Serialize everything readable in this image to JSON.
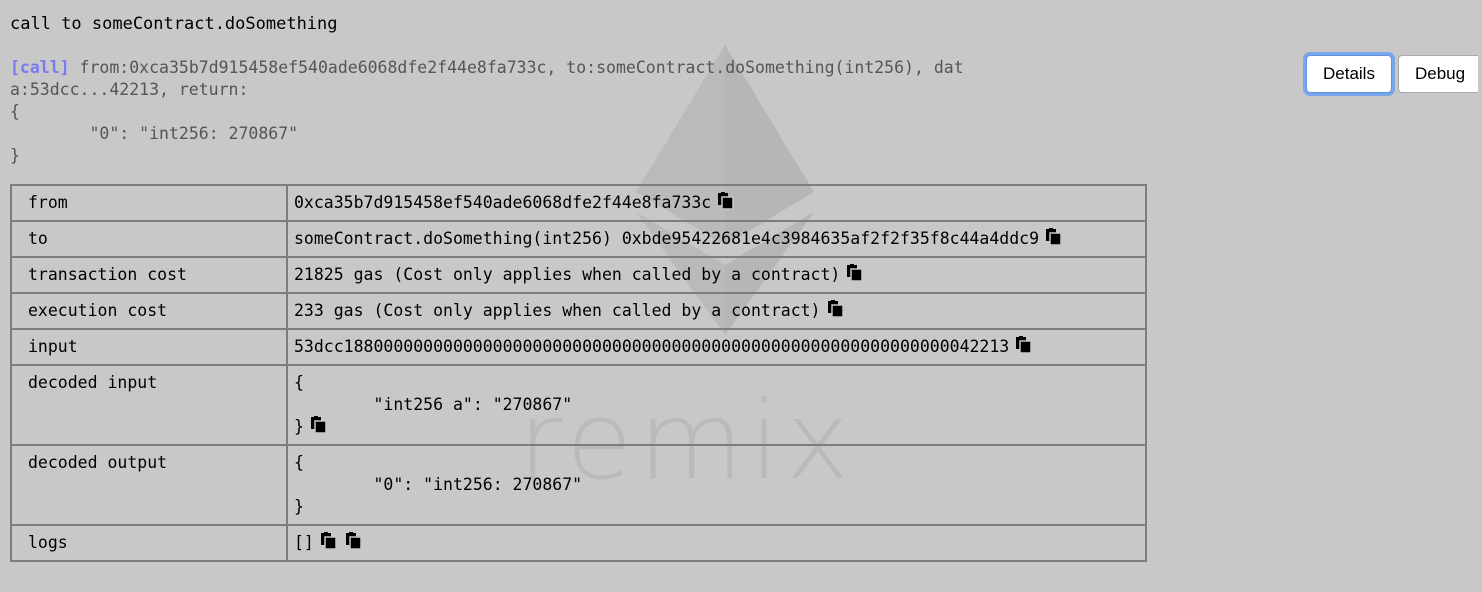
{
  "title": "call to someContract.doSomething",
  "log": {
    "tag": "[call]",
    "line1": " from:0xca35b7d915458ef540ade6068dfe2f44e8fa733c, to:someContract.doSomething(int256), dat",
    "line2": "a:53dcc...42213, return:",
    "line3": "{",
    "line4": "\t\"0\": \"int256: 270867\"",
    "line5": "}"
  },
  "buttons": {
    "details": "Details",
    "debug": "Debug"
  },
  "watermark": "remix",
  "rows": {
    "from": {
      "key": "from",
      "value": "0xca35b7d915458ef540ade6068dfe2f44e8fa733c"
    },
    "to": {
      "key": "to",
      "value": "someContract.doSomething(int256) 0xbde95422681e4c3984635af2f2f35f8c44a4ddc9"
    },
    "tx_cost": {
      "key": "transaction cost",
      "value": "21825 gas (Cost only applies when called by a contract)"
    },
    "exec_cost": {
      "key": "execution cost",
      "value": "233 gas (Cost only applies when called by a contract)"
    },
    "input": {
      "key": "input",
      "value": "53dcc1880000000000000000000000000000000000000000000000000000000000042213"
    },
    "decoded_input": {
      "key": "decoded input",
      "line1": "{",
      "line2": "\t\"int256 a\": \"270867\"",
      "line3": "}"
    },
    "decoded_output": {
      "key": "decoded output",
      "line1": "{",
      "line2": "\t\"0\": \"int256: 270867\"",
      "line3": "}"
    },
    "logs": {
      "key": "logs",
      "value": "[]"
    }
  },
  "icons": {
    "copy": "copy-icon",
    "ethereum": "ethereum-logo"
  }
}
